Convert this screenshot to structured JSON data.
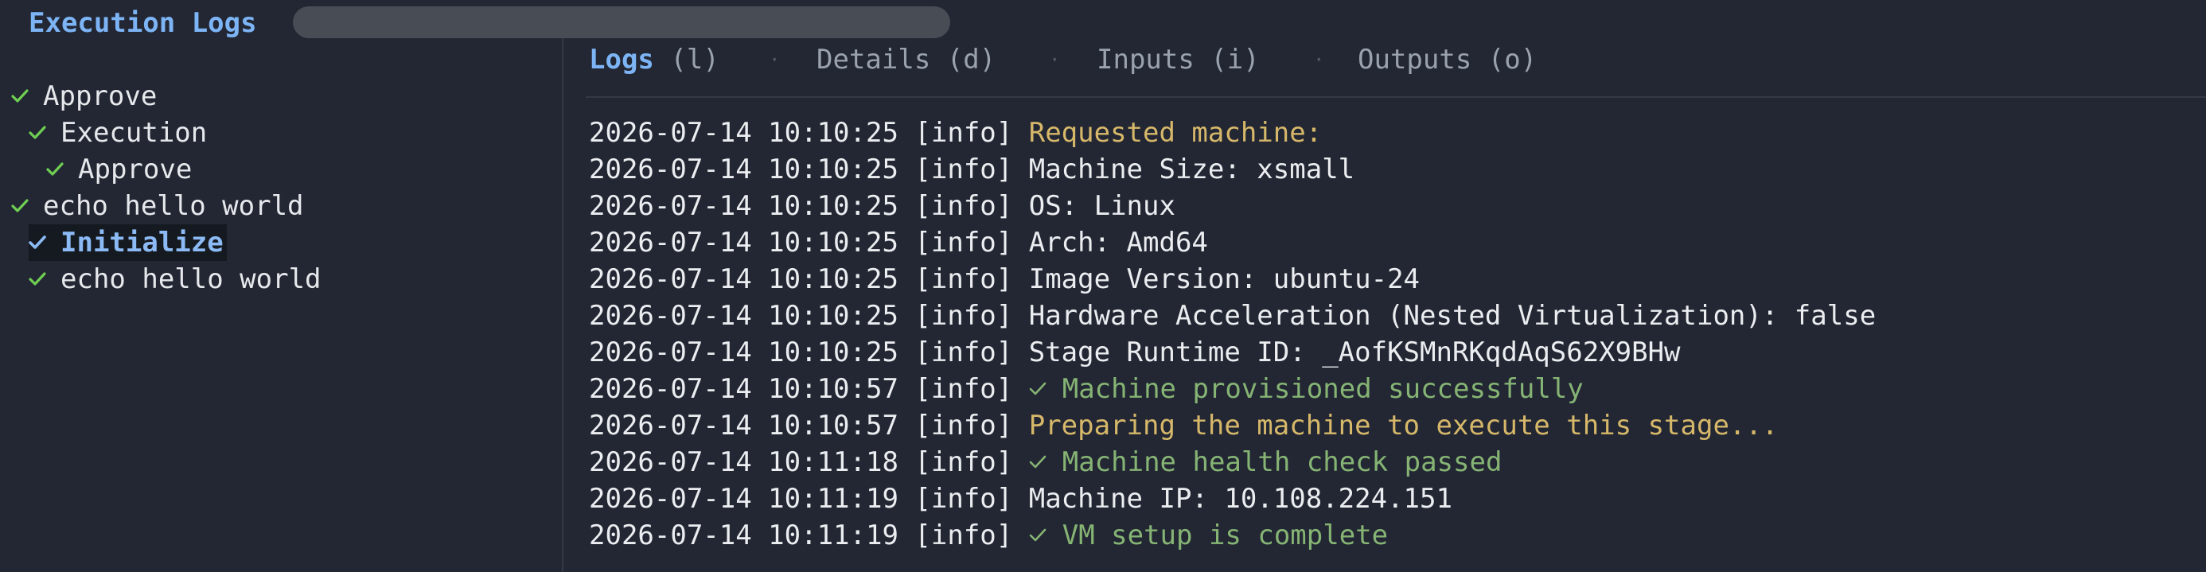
{
  "header": {
    "title": "Execution Logs",
    "progress": 0
  },
  "colors": {
    "background": "#222733",
    "accent": "#7db4f5",
    "check": "#6fcf52",
    "log_yellow": "#d7b86a",
    "log_green": "#86b474"
  },
  "tree": {
    "items": [
      {
        "label": "Approve",
        "level": 0,
        "status": "done",
        "selected": false
      },
      {
        "label": "Execution",
        "level": 1,
        "status": "done",
        "selected": false
      },
      {
        "label": "Approve",
        "level": 2,
        "status": "done",
        "selected": false
      },
      {
        "label": "echo hello world",
        "level": 0,
        "status": "done",
        "selected": false
      },
      {
        "label": "Initialize",
        "level": 1,
        "status": "done",
        "selected": true
      },
      {
        "label": "echo hello world",
        "level": 1,
        "status": "done",
        "selected": false
      }
    ]
  },
  "tabs": [
    {
      "name": "Logs",
      "key": "(l)",
      "active": true
    },
    {
      "name": "Details",
      "key": "(d)",
      "active": false
    },
    {
      "name": "Inputs",
      "key": "(i)",
      "active": false
    },
    {
      "name": "Outputs",
      "key": "(o)",
      "active": false
    }
  ],
  "tab_separator": "·",
  "logs": [
    {
      "timestamp": "2026-07-14 10:10:25",
      "level": "[info]",
      "message": "Requested machine:",
      "style": "yellow",
      "icon": ""
    },
    {
      "timestamp": "2026-07-14 10:10:25",
      "level": "[info]",
      "message": "Machine Size: xsmall",
      "style": "plain",
      "icon": ""
    },
    {
      "timestamp": "2026-07-14 10:10:25",
      "level": "[info]",
      "message": "OS: Linux",
      "style": "plain",
      "icon": ""
    },
    {
      "timestamp": "2026-07-14 10:10:25",
      "level": "[info]",
      "message": "Arch: Amd64",
      "style": "plain",
      "icon": ""
    },
    {
      "timestamp": "2026-07-14 10:10:25",
      "level": "[info]",
      "message": "Image Version: ubuntu-24",
      "style": "plain",
      "icon": ""
    },
    {
      "timestamp": "2026-07-14 10:10:25",
      "level": "[info]",
      "message": "Hardware Acceleration (Nested Virtualization): false",
      "style": "plain",
      "icon": ""
    },
    {
      "timestamp": "2026-07-14 10:10:25",
      "level": "[info]",
      "message": "Stage Runtime ID: _AofKSMnRKqdAqS62X9BHw",
      "style": "plain",
      "icon": ""
    },
    {
      "timestamp": "2026-07-14 10:10:57",
      "level": "[info]",
      "message": "Machine provisioned successfully",
      "style": "green",
      "icon": "check-icon"
    },
    {
      "timestamp": "2026-07-14 10:10:57",
      "level": "[info]",
      "message": "Preparing the machine to execute this stage...",
      "style": "yellow",
      "icon": ""
    },
    {
      "timestamp": "2026-07-14 10:11:18",
      "level": "[info]",
      "message": "Machine health check passed",
      "style": "green",
      "icon": "check-icon"
    },
    {
      "timestamp": "2026-07-14 10:11:19",
      "level": "[info]",
      "message": "Machine IP: 10.108.224.151",
      "style": "plain",
      "icon": ""
    },
    {
      "timestamp": "2026-07-14 10:11:19",
      "level": "[info]",
      "message": "VM setup is complete",
      "style": "green",
      "icon": "check-icon"
    }
  ]
}
